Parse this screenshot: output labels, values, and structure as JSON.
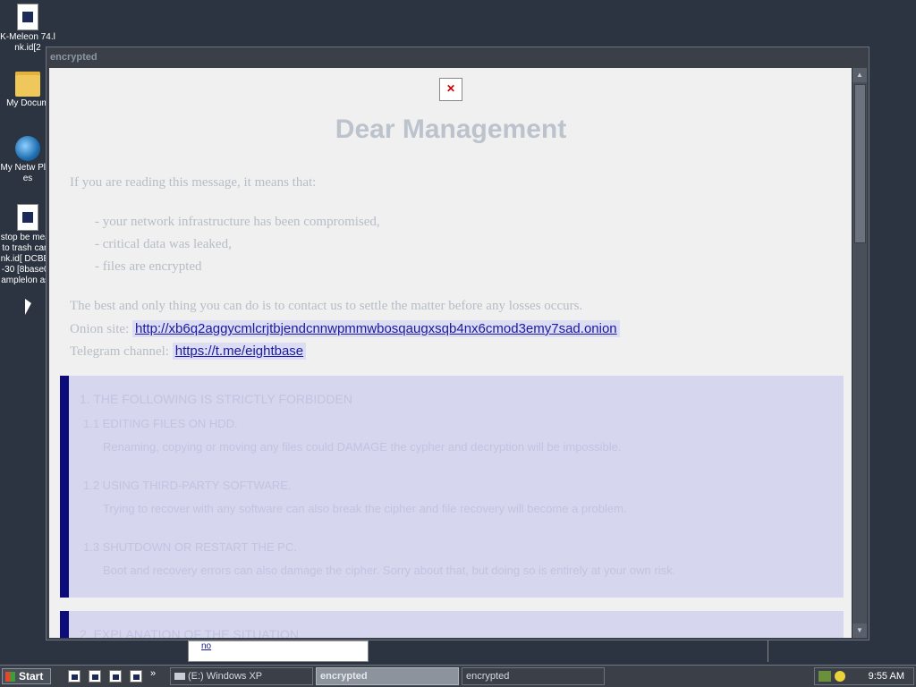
{
  "desktop": {
    "icons": [
      {
        "label": "K-Meleon 74.lnk.id[2",
        "icon": "shortcut-icon"
      },
      {
        "label": "My Docum",
        "icon": "folder-icon"
      },
      {
        "label": "My Netw Places",
        "icon": "network-icon"
      },
      {
        "label": "stop be mean to trash can.lnk.id[ DCBEF-30 [8base01 amplelon ase",
        "icon": "shortcut-icon"
      }
    ]
  },
  "window": {
    "title": "encrypted",
    "heading": "Dear Management",
    "intro": "If you are reading this message, it means that:",
    "bullets": [
      "- your network infrastructure has been compromised,",
      "- critical data was leaked,",
      "- files are encrypted"
    ],
    "contact_text": "The best and only thing you can do is to contact us to settle the matter before any losses occurs.",
    "onion_label": "Onion site:",
    "onion_link": "http://xb6q2aggycmlcrjtbjendcnnwpmmwbosqaugxsqb4nx6cmod3emy7sad.onion",
    "telegram_label": "Telegram channel:",
    "telegram_link": "https://t.me/eightbase",
    "section1": {
      "title": "1. THE FOLLOWING IS STRICTLY FORBIDDEN",
      "items": [
        {
          "title": "1.1 EDITING FILES ON HDD.",
          "text": "Renaming, copying or moving any files could DAMAGE the cypher and decryption will be impossible."
        },
        {
          "title": "1.2 USING THIRD-PARTY SOFTWARE.",
          "text": "Trying to recover with any software can also break the cipher and file recovery will become a problem."
        },
        {
          "title": "1.3 SHUTDOWN OR RESTART THE PC.",
          "text": "Boot and recovery errors can also damage the cipher. Sorry about that, but doing so is entirely at your own risk."
        }
      ]
    },
    "section2": {
      "title": "2. EXPLANATION OF THE SITUATION"
    }
  },
  "background_window": {
    "link_text": "no"
  },
  "taskbar": {
    "start_label": "Start",
    "more": "»",
    "tasks": [
      {
        "label": "(E:) Windows XP",
        "active": false
      },
      {
        "label": "encrypted",
        "active": true
      },
      {
        "label": "encrypted",
        "active": false
      }
    ],
    "clock": "9:55 AM"
  },
  "colors": {
    "panel_border": "#0c0c7a",
    "link": "#1a1a9e",
    "desktop": "#2b3440"
  }
}
